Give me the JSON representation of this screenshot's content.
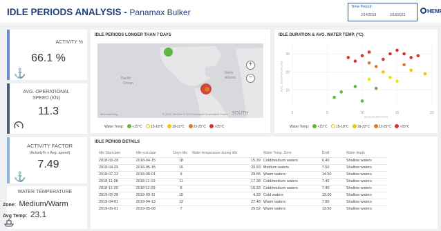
{
  "header": {
    "title": "IDLE PERIODS ANALYSIS",
    "separator": " - ",
    "vessel": "Panamax Bulker",
    "period_label": "Time Period:",
    "period_start": "2/14/2018",
    "period_end": "2/18/2023",
    "logo_text": "HEMP"
  },
  "kpis": {
    "activity": {
      "label": "ACTIVITY %",
      "value": "66.1 %",
      "icon": "anchor-icon",
      "accent": "#6b8ccc"
    },
    "speed": {
      "label_line1": "AVG. OPERATIONAL",
      "label_line2": "SPEED (KN)",
      "value": "11.3",
      "icon": "gauge-icon",
      "accent": "#4e5d7a"
    },
    "factor": {
      "label_line1": "ACTIVITY FACTOR",
      "label_line2": "(Activity% x Avg. speed)",
      "value": "7.49",
      "icon": "anchor-icon",
      "accent": "#8fb5e6"
    },
    "water": {
      "label": "WATER TEMPERATURE",
      "zone_label": "Zone:",
      "zone_value": "Medium/Warm",
      "temp_label": "Avg Temp:",
      "temp_value": "23.1",
      "icon": "ship-icon"
    }
  },
  "map_panel": {
    "title": "IDLE PERIODS LONGER THAN 7 DAYS",
    "labels": [
      "Pacific",
      "Ocean",
      "North",
      "Atlantic",
      "SOUTH"
    ],
    "credit": "© 2023 TomTom © 2023 Microsoft Corporation Terms",
    "provider": "Microsoft Bing",
    "zoom_in": "+",
    "zoom_out": "−",
    "legend_title": "Water Temp:",
    "legend": [
      {
        "label": "<15°C",
        "color": "#62b63d"
      },
      {
        "label": "15-18°C",
        "color": "#e6e600",
        "hollow": true
      },
      {
        "label": "18-22°C",
        "color": "#f2c500"
      },
      {
        "label": "22-25°C",
        "color": "#e07a24"
      },
      {
        "label": ">25°C",
        "color": "#d0362b"
      }
    ]
  },
  "scatter_panel": {
    "title": "IDLE DURATION & AVG. WATER TEMP. (°C)",
    "legend_title": "Water Temp:"
  },
  "chart_data": {
    "type": "scatter",
    "title": "IDLE DURATION & AVG. WATER TEMP. (°C)",
    "xlabel": "IDLE DURATION",
    "ylabel": "AVG. TEMPERATURE",
    "x_ticks": [
      "0",
      "5",
      "10",
      "15",
      "20"
    ],
    "xlim": [
      0,
      20
    ],
    "ylim": [
      0,
      35
    ],
    "y_ticks": [
      "10",
      "20",
      "30"
    ],
    "grid": true,
    "legend_position": "bottom",
    "series": [
      {
        "name": "<15°C",
        "color": "#62b63d",
        "points": [
          [
            6,
            6
          ],
          [
            7,
            9
          ],
          [
            9,
            12
          ],
          [
            10,
            4
          ],
          [
            12,
            11
          ]
        ]
      },
      {
        "name": "15-18°C",
        "color": "#e6e600",
        "points": [
          [
            11,
            16
          ],
          [
            14,
            17
          ],
          [
            15,
            15
          ]
        ]
      },
      {
        "name": "18-22°C",
        "color": "#f2c500",
        "points": [
          [
            13,
            20
          ],
          [
            17,
            21
          ],
          [
            19,
            19
          ]
        ]
      },
      {
        "name": "22-25°C",
        "color": "#e07a24",
        "points": [
          [
            12,
            23
          ],
          [
            16,
            24
          ],
          [
            11,
            25
          ]
        ]
      },
      {
        "name": ">25°C",
        "color": "#d0362b",
        "points": [
          [
            8,
            28
          ],
          [
            10,
            29
          ],
          [
            11,
            31
          ],
          [
            13,
            27
          ],
          [
            14,
            30
          ],
          [
            15,
            32
          ],
          [
            16,
            30
          ],
          [
            17,
            28
          ],
          [
            9,
            26
          ],
          [
            18,
            29
          ]
        ]
      }
    ]
  },
  "details": {
    "title": "IDLE PERIOD DETAILS",
    "columns": [
      "Idle Start date",
      "Idle end date",
      "Days idle",
      "Water temperature during idle",
      "Water Temp. Zone",
      "Draft",
      "Water depth"
    ],
    "rows": [
      [
        "2018-03-28",
        "2018-04-15",
        "18",
        "15.39",
        "Cold/medium waters",
        "6.40",
        "Shallow waters"
      ],
      [
        "2018-04-29",
        "2018-05-15",
        "16",
        "20.93",
        "Medium waters",
        "7.50",
        "Shallow waters"
      ],
      [
        "2018-07-22",
        "2018-08-01",
        "9",
        "29.55",
        "Warm waters",
        "14.50",
        "Shallow waters"
      ],
      [
        "2018-11-08",
        "2018-11-19",
        "11",
        "17.38",
        "Cold/medium waters",
        "7.40",
        "Shallow waters"
      ],
      [
        "2018-11-20",
        "2018-11-29",
        "8",
        "16.33",
        "Cold/medium waters",
        "7.40",
        "Shallow waters"
      ],
      [
        "2019-02-28",
        "2019-03-11",
        "10",
        "4.33",
        "Cold waters",
        "13.00",
        "Shallow waters"
      ],
      [
        "2019-04-01",
        "2019-04-13",
        "12",
        "27.48",
        "Warm waters",
        "7.00",
        "Shallow waters"
      ],
      [
        "2019-05-01",
        "2019-05-08",
        "7",
        "25.52",
        "Warm waters",
        "13.50",
        "Shallow waters"
      ]
    ]
  }
}
